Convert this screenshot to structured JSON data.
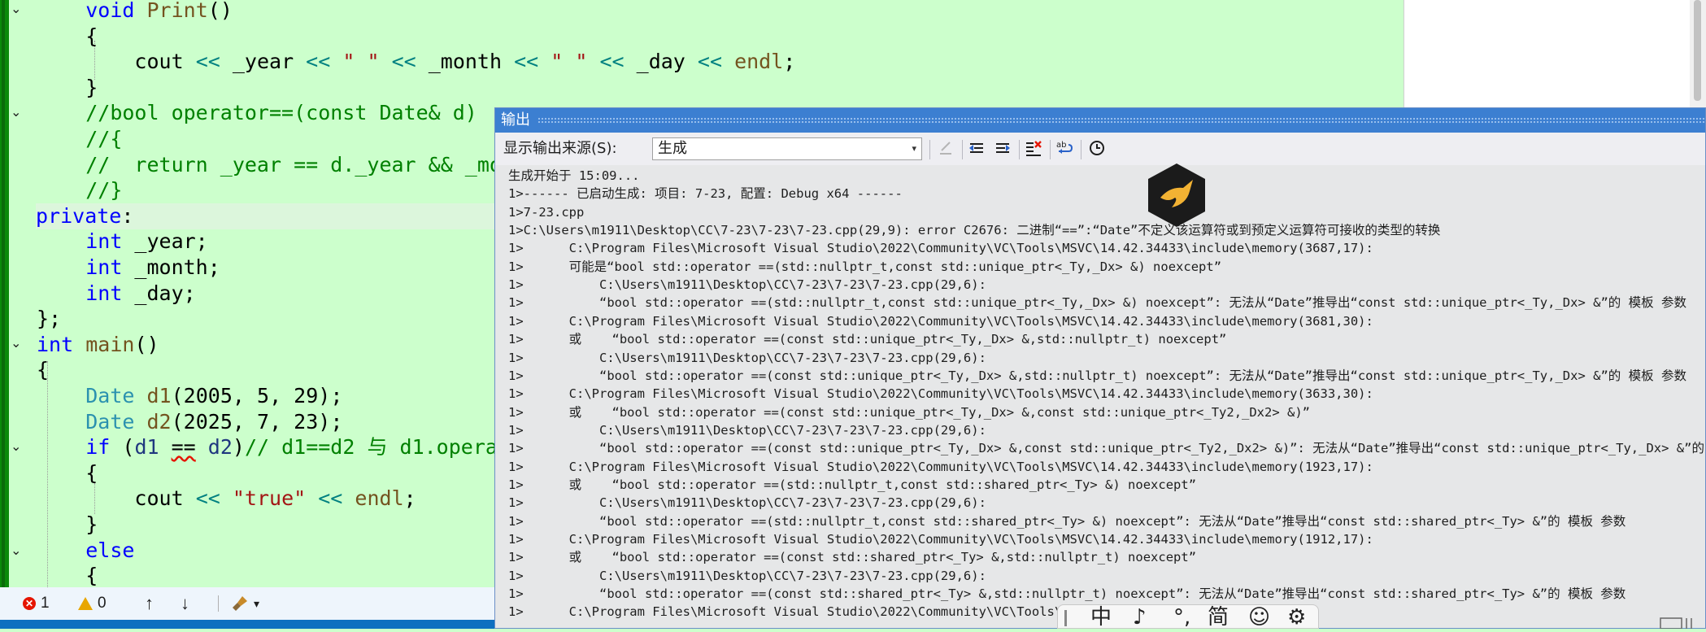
{
  "editor": {
    "lines": [
      {
        "text": "    void Print()"
      },
      {
        "text": "    {"
      },
      {
        "text": "        cout << _year << \" \" << _month << \" \" << _day << endl;"
      },
      {
        "text": "    }"
      },
      {
        "text": "    //bool operator==(const Date& d)"
      },
      {
        "text": "    //{"
      },
      {
        "text": "    //  return _year == d._year && _mo"
      },
      {
        "text": "    //}"
      },
      {
        "text": "private:"
      },
      {
        "text": "    int _year;"
      },
      {
        "text": "    int _month;"
      },
      {
        "text": "    int _day;"
      },
      {
        "text": "};"
      },
      {
        "text": "int main()"
      },
      {
        "text": "{"
      },
      {
        "text": "    Date d1(2005, 5, 29);"
      },
      {
        "text": "    Date d2(2025, 7, 23);"
      },
      {
        "text": "    if (d1 == d2)// d1==d2 与 d1.opera"
      },
      {
        "text": "    {"
      },
      {
        "text": "        cout << \"true\" << endl;"
      },
      {
        "text": "    }"
      },
      {
        "text": "    else"
      },
      {
        "text": "    {"
      }
    ]
  },
  "status_bar": {
    "errors": "1",
    "warnings": "0",
    "up_arrow": "↑",
    "down_arrow": "↓",
    "cleanup_caret": "▾"
  },
  "output": {
    "title": "输出",
    "source_label": "显示输出来源(S):",
    "source_value": "生成",
    "caret": "▾",
    "log": [
      "生成开始于 15:09...",
      "1>------ 已启动生成: 项目: 7-23, 配置: Debug x64 ------",
      "1>7-23.cpp",
      "1>C:\\Users\\m1911\\Desktop\\CC\\7-23\\7-23\\7-23.cpp(29,9): error C2676: 二进制“==”:“Date”不定义该运算符或到预定义运算符可接收的类型的转换",
      "1>      C:\\Program Files\\Microsoft Visual Studio\\2022\\Community\\VC\\Tools\\MSVC\\14.42.34433\\include\\memory(3687,17):",
      "1>      可能是“bool std::operator ==(std::nullptr_t,const std::unique_ptr<_Ty,_Dx> &) noexcept”",
      "1>          C:\\Users\\m1911\\Desktop\\CC\\7-23\\7-23\\7-23.cpp(29,6):",
      "1>          “bool std::operator ==(std::nullptr_t,const std::unique_ptr<_Ty,_Dx> &) noexcept”: 无法从“Date”推导出“const std::unique_ptr<_Ty,_Dx> &”的 模板 参数",
      "1>      C:\\Program Files\\Microsoft Visual Studio\\2022\\Community\\VC\\Tools\\MSVC\\14.42.34433\\include\\memory(3681,30):",
      "1>      或    “bool std::operator ==(const std::unique_ptr<_Ty,_Dx> &,std::nullptr_t) noexcept”",
      "1>          C:\\Users\\m1911\\Desktop\\CC\\7-23\\7-23\\7-23.cpp(29,6):",
      "1>          “bool std::operator ==(const std::unique_ptr<_Ty,_Dx> &,std::nullptr_t) noexcept”: 无法从“Date”推导出“const std::unique_ptr<_Ty,_Dx> &”的 模板 参数",
      "1>      C:\\Program Files\\Microsoft Visual Studio\\2022\\Community\\VC\\Tools\\MSVC\\14.42.34433\\include\\memory(3633,30):",
      "1>      或    “bool std::operator ==(const std::unique_ptr<_Ty,_Dx> &,const std::unique_ptr<_Ty2,_Dx2> &)”",
      "1>          C:\\Users\\m1911\\Desktop\\CC\\7-23\\7-23\\7-23.cpp(29,6):",
      "1>          “bool std::operator ==(const std::unique_ptr<_Ty,_Dx> &,const std::unique_ptr<_Ty2,_Dx2> &)”: 无法从“Date”推导出“const std::unique_ptr<_Ty,_Dx> &”的",
      "1>      C:\\Program Files\\Microsoft Visual Studio\\2022\\Community\\VC\\Tools\\MSVC\\14.42.34433\\include\\memory(1923,17):",
      "1>      或    “bool std::operator ==(std::nullptr_t,const std::shared_ptr<_Ty> &) noexcept”",
      "1>          C:\\Users\\m1911\\Desktop\\CC\\7-23\\7-23\\7-23.cpp(29,6):",
      "1>          “bool std::operator ==(std::nullptr_t,const std::shared_ptr<_Ty> &) noexcept”: 无法从“Date”推导出“const std::shared_ptr<_Ty> &”的 模板 参数",
      "1>      C:\\Program Files\\Microsoft Visual Studio\\2022\\Community\\VC\\Tools\\MSVC\\14.42.34433\\include\\memory(1912,17):",
      "1>      或    “bool std::operator ==(const std::shared_ptr<_Ty> &,std::nullptr_t) noexcept”",
      "1>          C:\\Users\\m1911\\Desktop\\CC\\7-23\\7-23\\7-23.cpp(29,6):",
      "1>          “bool std::operator ==(const std::shared_ptr<_Ty> &,std::nullptr_t) noexcept”: 无法从“Date”推导出“const std::shared_ptr<_Ty> &”的 模板 参数",
      "1>      C:\\Program Files\\Microsoft Visual Studio\\2022\\Community\\VC\\Tools\\MSVC"
    ]
  },
  "ime": {
    "mode": "中",
    "punct": "♪",
    "dot": "°,",
    "simplified": "简",
    "emoji": "☺",
    "settings": "⚙"
  },
  "colors": {
    "editor_bg": "#ccffcc",
    "output_bg": "#e6e7e8",
    "titlebar": "#3c7fd1",
    "status_accent": "#0e70c0",
    "error": "#e51400"
  }
}
